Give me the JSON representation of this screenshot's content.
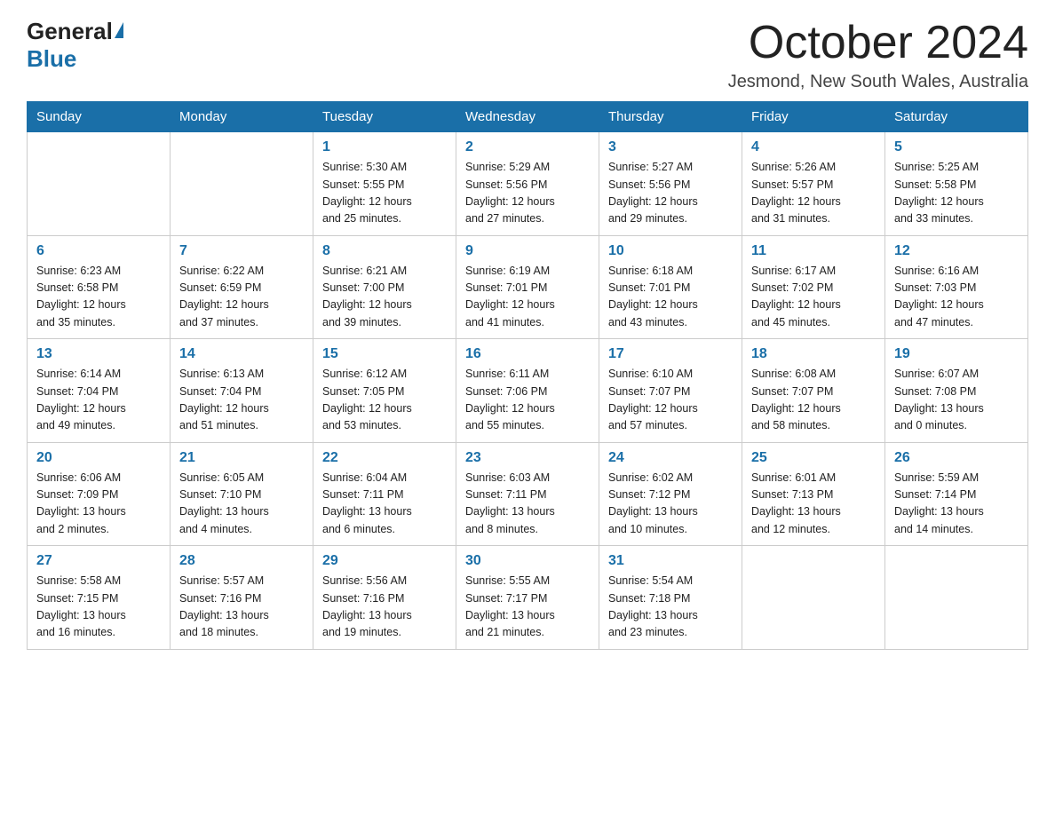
{
  "header": {
    "logo": {
      "general": "General",
      "blue": "Blue"
    },
    "title": "October 2024",
    "subtitle": "Jesmond, New South Wales, Australia"
  },
  "weekdays": [
    "Sunday",
    "Monday",
    "Tuesday",
    "Wednesday",
    "Thursday",
    "Friday",
    "Saturday"
  ],
  "weeks": [
    [
      {
        "day": "",
        "info": ""
      },
      {
        "day": "",
        "info": ""
      },
      {
        "day": "1",
        "info": "Sunrise: 5:30 AM\nSunset: 5:55 PM\nDaylight: 12 hours\nand 25 minutes."
      },
      {
        "day": "2",
        "info": "Sunrise: 5:29 AM\nSunset: 5:56 PM\nDaylight: 12 hours\nand 27 minutes."
      },
      {
        "day": "3",
        "info": "Sunrise: 5:27 AM\nSunset: 5:56 PM\nDaylight: 12 hours\nand 29 minutes."
      },
      {
        "day": "4",
        "info": "Sunrise: 5:26 AM\nSunset: 5:57 PM\nDaylight: 12 hours\nand 31 minutes."
      },
      {
        "day": "5",
        "info": "Sunrise: 5:25 AM\nSunset: 5:58 PM\nDaylight: 12 hours\nand 33 minutes."
      }
    ],
    [
      {
        "day": "6",
        "info": "Sunrise: 6:23 AM\nSunset: 6:58 PM\nDaylight: 12 hours\nand 35 minutes."
      },
      {
        "day": "7",
        "info": "Sunrise: 6:22 AM\nSunset: 6:59 PM\nDaylight: 12 hours\nand 37 minutes."
      },
      {
        "day": "8",
        "info": "Sunrise: 6:21 AM\nSunset: 7:00 PM\nDaylight: 12 hours\nand 39 minutes."
      },
      {
        "day": "9",
        "info": "Sunrise: 6:19 AM\nSunset: 7:01 PM\nDaylight: 12 hours\nand 41 minutes."
      },
      {
        "day": "10",
        "info": "Sunrise: 6:18 AM\nSunset: 7:01 PM\nDaylight: 12 hours\nand 43 minutes."
      },
      {
        "day": "11",
        "info": "Sunrise: 6:17 AM\nSunset: 7:02 PM\nDaylight: 12 hours\nand 45 minutes."
      },
      {
        "day": "12",
        "info": "Sunrise: 6:16 AM\nSunset: 7:03 PM\nDaylight: 12 hours\nand 47 minutes."
      }
    ],
    [
      {
        "day": "13",
        "info": "Sunrise: 6:14 AM\nSunset: 7:04 PM\nDaylight: 12 hours\nand 49 minutes."
      },
      {
        "day": "14",
        "info": "Sunrise: 6:13 AM\nSunset: 7:04 PM\nDaylight: 12 hours\nand 51 minutes."
      },
      {
        "day": "15",
        "info": "Sunrise: 6:12 AM\nSunset: 7:05 PM\nDaylight: 12 hours\nand 53 minutes."
      },
      {
        "day": "16",
        "info": "Sunrise: 6:11 AM\nSunset: 7:06 PM\nDaylight: 12 hours\nand 55 minutes."
      },
      {
        "day": "17",
        "info": "Sunrise: 6:10 AM\nSunset: 7:07 PM\nDaylight: 12 hours\nand 57 minutes."
      },
      {
        "day": "18",
        "info": "Sunrise: 6:08 AM\nSunset: 7:07 PM\nDaylight: 12 hours\nand 58 minutes."
      },
      {
        "day": "19",
        "info": "Sunrise: 6:07 AM\nSunset: 7:08 PM\nDaylight: 13 hours\nand 0 minutes."
      }
    ],
    [
      {
        "day": "20",
        "info": "Sunrise: 6:06 AM\nSunset: 7:09 PM\nDaylight: 13 hours\nand 2 minutes."
      },
      {
        "day": "21",
        "info": "Sunrise: 6:05 AM\nSunset: 7:10 PM\nDaylight: 13 hours\nand 4 minutes."
      },
      {
        "day": "22",
        "info": "Sunrise: 6:04 AM\nSunset: 7:11 PM\nDaylight: 13 hours\nand 6 minutes."
      },
      {
        "day": "23",
        "info": "Sunrise: 6:03 AM\nSunset: 7:11 PM\nDaylight: 13 hours\nand 8 minutes."
      },
      {
        "day": "24",
        "info": "Sunrise: 6:02 AM\nSunset: 7:12 PM\nDaylight: 13 hours\nand 10 minutes."
      },
      {
        "day": "25",
        "info": "Sunrise: 6:01 AM\nSunset: 7:13 PM\nDaylight: 13 hours\nand 12 minutes."
      },
      {
        "day": "26",
        "info": "Sunrise: 5:59 AM\nSunset: 7:14 PM\nDaylight: 13 hours\nand 14 minutes."
      }
    ],
    [
      {
        "day": "27",
        "info": "Sunrise: 5:58 AM\nSunset: 7:15 PM\nDaylight: 13 hours\nand 16 minutes."
      },
      {
        "day": "28",
        "info": "Sunrise: 5:57 AM\nSunset: 7:16 PM\nDaylight: 13 hours\nand 18 minutes."
      },
      {
        "day": "29",
        "info": "Sunrise: 5:56 AM\nSunset: 7:16 PM\nDaylight: 13 hours\nand 19 minutes."
      },
      {
        "day": "30",
        "info": "Sunrise: 5:55 AM\nSunset: 7:17 PM\nDaylight: 13 hours\nand 21 minutes."
      },
      {
        "day": "31",
        "info": "Sunrise: 5:54 AM\nSunset: 7:18 PM\nDaylight: 13 hours\nand 23 minutes."
      },
      {
        "day": "",
        "info": ""
      },
      {
        "day": "",
        "info": ""
      }
    ]
  ]
}
